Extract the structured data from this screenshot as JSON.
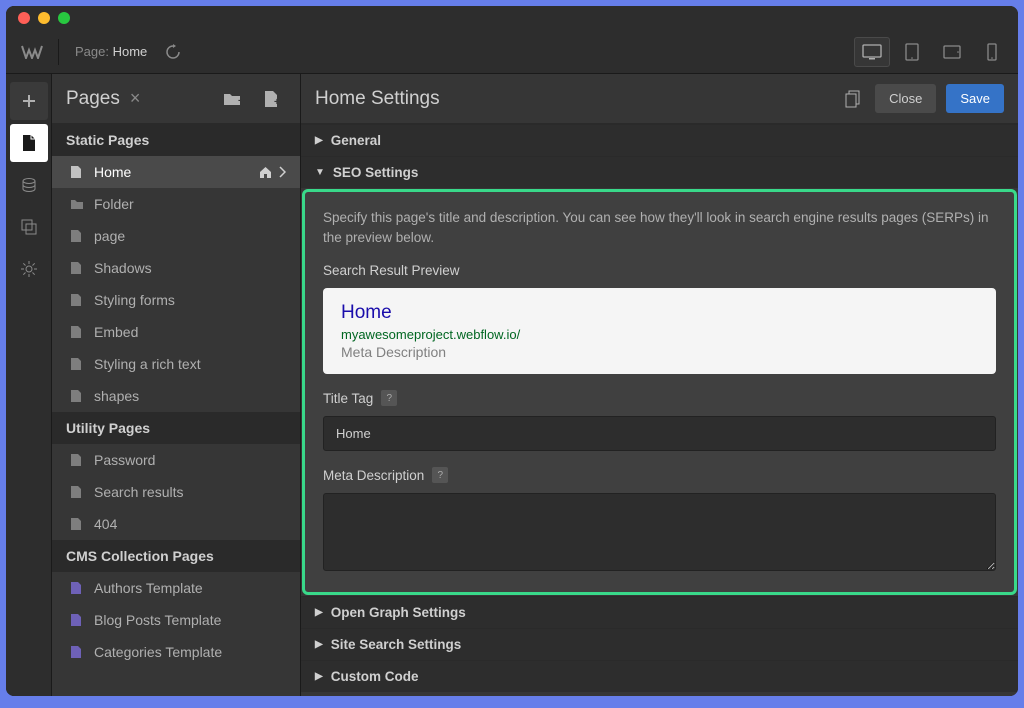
{
  "topbar": {
    "page_label": "Page:",
    "page_name": "Home"
  },
  "pages_panel": {
    "title": "Pages",
    "sections": {
      "static": "Static Pages",
      "utility": "Utility Pages",
      "cms": "CMS Collection Pages"
    },
    "static_items": [
      "Home",
      "Folder",
      "page",
      "Shadows",
      "Styling forms",
      "Embed",
      "Styling a rich text",
      "shapes"
    ],
    "utility_items": [
      "Password",
      "Search results",
      "404"
    ],
    "cms_items": [
      "Authors Template",
      "Blog Posts Template",
      "Categories Template"
    ]
  },
  "settings": {
    "title": "Home Settings",
    "close": "Close",
    "save": "Save",
    "sections": {
      "general": "General",
      "seo": "SEO Settings",
      "og": "Open Graph Settings",
      "search": "Site Search Settings",
      "custom": "Custom Code"
    },
    "seo": {
      "desc": "Specify this page's title and description. You can see how they'll look in search engine results pages (SERPs) in the preview below.",
      "preview_label": "Search Result Preview",
      "preview_title": "Home",
      "preview_url": "myawesomeproject.webflow.io/",
      "preview_meta": "Meta Description",
      "title_tag_label": "Title Tag",
      "title_tag_value": "Home",
      "meta_label": "Meta Description",
      "meta_value": ""
    }
  }
}
